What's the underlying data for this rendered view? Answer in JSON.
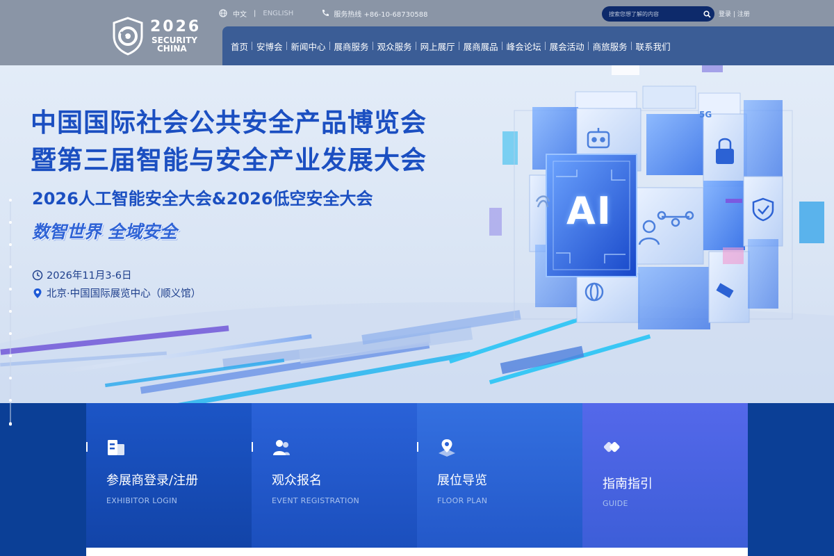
{
  "logo": {
    "year": "2026",
    "line1": "SECURITY",
    "line2": "CHINA"
  },
  "topbar": {
    "lang_cn": "中文",
    "separator": "|",
    "lang_en": "ENGLISH",
    "hotline": "服务热线 +86-10-68730588"
  },
  "search": {
    "placeholder": "搜索您想了解的内容"
  },
  "auth": {
    "login": "登录",
    "sep": "|",
    "register": "注册"
  },
  "nav": {
    "items": [
      "首页",
      "安博会",
      "新闻中心",
      "展商服务",
      "观众服务",
      "网上展厅",
      "展商展品",
      "峰会论坛",
      "展会活动",
      "商旅服务",
      "联系我们"
    ]
  },
  "hero": {
    "title_line1": "中国国际社会公共安全产品博览会",
    "title_line2": "暨第三届智能与安全产业发展大会",
    "subtitle": "2026人工智能安全大会&2026低空安全大会",
    "slogan": "数智世界 全域安全",
    "date": "2026年11月3-6日",
    "venue": "北京·中国国际展览中心（顺义馆）",
    "cube_label": "AI",
    "cube_badge": "5G"
  },
  "quick_links": [
    {
      "title": "参展商登录/注册",
      "subtitle": "EXHIBITOR LOGIN",
      "icon": "exhibitor-icon"
    },
    {
      "title": "观众报名",
      "subtitle": "EVENT REGISTRATION",
      "icon": "users-icon"
    },
    {
      "title": "展位导览",
      "subtitle": "FLOOR PLAN",
      "icon": "location-pin-icon"
    },
    {
      "title": "指南指引",
      "subtitle": "GUIDE",
      "icon": "guide-icon"
    }
  ],
  "colors": {
    "header_bg": "#8a95a6",
    "nav_bg": "#3b5d96",
    "title_blue": "#1b4fc1",
    "page_blue": "#0b3f96"
  }
}
